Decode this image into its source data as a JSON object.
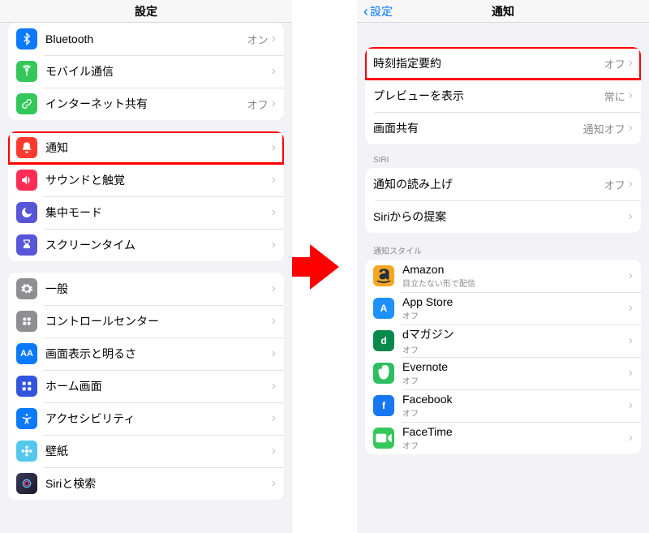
{
  "left": {
    "title": "設定",
    "group1": [
      {
        "id": "bluetooth",
        "label": "Bluetooth",
        "value": "オン",
        "iconColor": "#0a7aff"
      },
      {
        "id": "cellular",
        "label": "モバイル通信",
        "value": "",
        "iconColor": "#34c759"
      },
      {
        "id": "hotspot",
        "label": "インターネット共有",
        "value": "オフ",
        "iconColor": "#34c759"
      }
    ],
    "group2": [
      {
        "id": "notifications",
        "label": "通知",
        "value": "",
        "iconColor": "#ff3b30",
        "highlight": true
      },
      {
        "id": "sounds",
        "label": "サウンドと触覚",
        "value": "",
        "iconColor": "#ff2d55"
      },
      {
        "id": "focus",
        "label": "集中モード",
        "value": "",
        "iconColor": "#5856d6"
      },
      {
        "id": "screentime",
        "label": "スクリーンタイム",
        "value": "",
        "iconColor": "#5856d6"
      }
    ],
    "group3": [
      {
        "id": "general",
        "label": "一般",
        "value": "",
        "iconColor": "#8e8e93"
      },
      {
        "id": "controlcenter",
        "label": "コントロールセンター",
        "value": "",
        "iconColor": "#8e8e93"
      },
      {
        "id": "display",
        "label": "画面表示と明るさ",
        "value": "",
        "iconColor": "#0a7aff"
      },
      {
        "id": "homescreen",
        "label": "ホーム画面",
        "value": "",
        "iconColor": "#3355dd"
      },
      {
        "id": "accessibility",
        "label": "アクセシビリティ",
        "value": "",
        "iconColor": "#0a7aff"
      },
      {
        "id": "wallpaper",
        "label": "壁紙",
        "value": "",
        "iconColor": "#54c7ec"
      },
      {
        "id": "siri",
        "label": "Siriと検索",
        "value": "",
        "iconColor": "#1a1a2a"
      }
    ]
  },
  "right": {
    "back": "設定",
    "title": "通知",
    "group1": [
      {
        "id": "scheduled-summary",
        "label": "時刻指定要約",
        "value": "オフ",
        "highlight": true
      },
      {
        "id": "show-previews",
        "label": "プレビューを表示",
        "value": "常に"
      },
      {
        "id": "screen-sharing",
        "label": "画面共有",
        "value": "通知オフ"
      }
    ],
    "siriHeader": "SIRI",
    "group2": [
      {
        "id": "announce",
        "label": "通知の読み上げ",
        "value": "オフ"
      },
      {
        "id": "siri-suggestions",
        "label": "Siriからの提案",
        "value": ""
      }
    ],
    "styleHeader": "通知スタイル",
    "apps": [
      {
        "id": "amazon",
        "label": "Amazon",
        "sub": "目立たない形で配信",
        "bg": "#f5a623"
      },
      {
        "id": "appstore",
        "label": "App Store",
        "sub": "オフ",
        "bg": "#1e90ff",
        "glyph": "A"
      },
      {
        "id": "dmagazine",
        "label": "dマガジン",
        "sub": "オフ",
        "bg": "#0a8a4a",
        "glyph": "d"
      },
      {
        "id": "evernote",
        "label": "Evernote",
        "sub": "オフ",
        "bg": "#2dbe60"
      },
      {
        "id": "facebook",
        "label": "Facebook",
        "sub": "オフ",
        "bg": "#1877f2",
        "glyph": "f"
      },
      {
        "id": "facetime",
        "label": "FaceTime",
        "sub": "オフ",
        "bg": "#34c759"
      }
    ]
  }
}
